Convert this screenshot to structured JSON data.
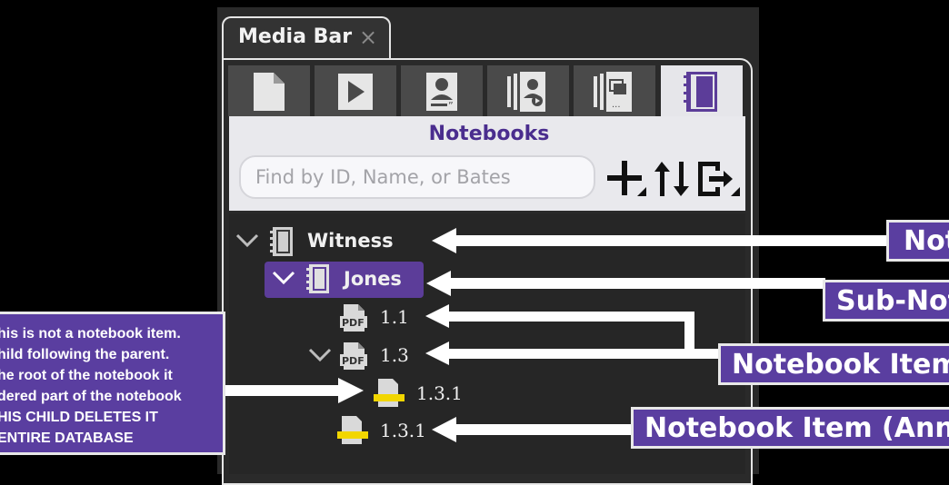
{
  "tab": {
    "title": "Media Bar",
    "close": "×"
  },
  "icon_tabs": [
    {
      "icon": "document-icon"
    },
    {
      "icon": "play-icon"
    },
    {
      "icon": "witness-icon"
    },
    {
      "icon": "multi-witness-icon"
    },
    {
      "icon": "stacked-documents-icon"
    },
    {
      "icon": "notebook-icon",
      "active": true
    }
  ],
  "panel": {
    "title": "Notebooks",
    "search_placeholder": "Find by ID, Name, or Bates"
  },
  "tree": {
    "root": "Witness",
    "sub": "Jones",
    "items": [
      "1.1",
      "1.3",
      "1.3.1",
      "1.3.1"
    ],
    "pdf_label": "PDF"
  },
  "callouts": {
    "notebook": "Not",
    "sub_notebook": "Sub-Not",
    "notebook_item": "Notebook Item",
    "annotation": "Notebook Item (Anno"
  },
  "note": {
    "lines": [
      "his is not a notebook item.",
      "hild following the parent.",
      "he root of the notebook it",
      "dered part of the notebook",
      "HIS CHILD DELETES IT",
      "ENTIRE DATABASE"
    ]
  },
  "colors": {
    "accent": "#5a3ea0",
    "highlight": "#f2d600",
    "title": "#4a2d8e"
  }
}
